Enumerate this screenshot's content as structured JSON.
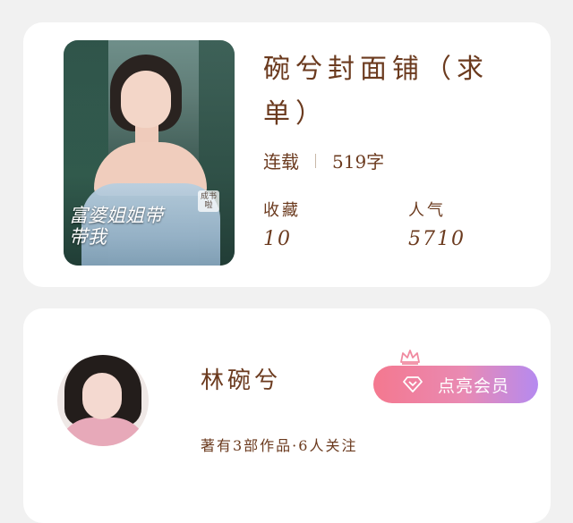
{
  "book": {
    "title": "碗兮封面铺（求单）",
    "status": "连载",
    "word_count": "519字",
    "cover": {
      "title": "富婆姐姐带带我",
      "stamp": "成书啦"
    },
    "stats": [
      {
        "label": "收藏",
        "value": "10"
      },
      {
        "label": "人气",
        "value": "5710"
      }
    ]
  },
  "author": {
    "name": "林碗兮",
    "info": "著有3部作品·6人关注",
    "vip_button_label": "点亮会员",
    "icons": {
      "crown": "crown-icon",
      "diamond": "diamond-icon"
    }
  },
  "colors": {
    "text_brown": "#6b3a1e",
    "background": "#f1f1f1",
    "card": "#ffffff",
    "vip_gradient_start": "#f4788f",
    "vip_gradient_end": "#b58af0"
  }
}
